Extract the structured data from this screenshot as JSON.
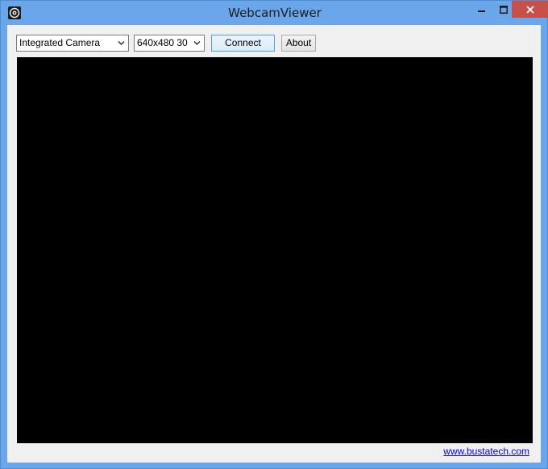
{
  "window": {
    "title": "WebcamViewer",
    "icon": "webcam-icon"
  },
  "titlebar_buttons": {
    "minimize": "minimize-icon",
    "maximize": "maximize-icon",
    "close": "close-icon"
  },
  "toolbar": {
    "camera_select": {
      "value": "Integrated Camera"
    },
    "resolution_select": {
      "value": "640x480 30"
    },
    "connect_label": "Connect",
    "about_label": "About"
  },
  "video": {
    "background": "#000000"
  },
  "footer": {
    "link_text": "www.bustatech.com"
  },
  "colors": {
    "frame": "#6aa6e9",
    "close_button": "#c7504b",
    "client_background": "#f0f0f0",
    "link": "#0000ee"
  }
}
